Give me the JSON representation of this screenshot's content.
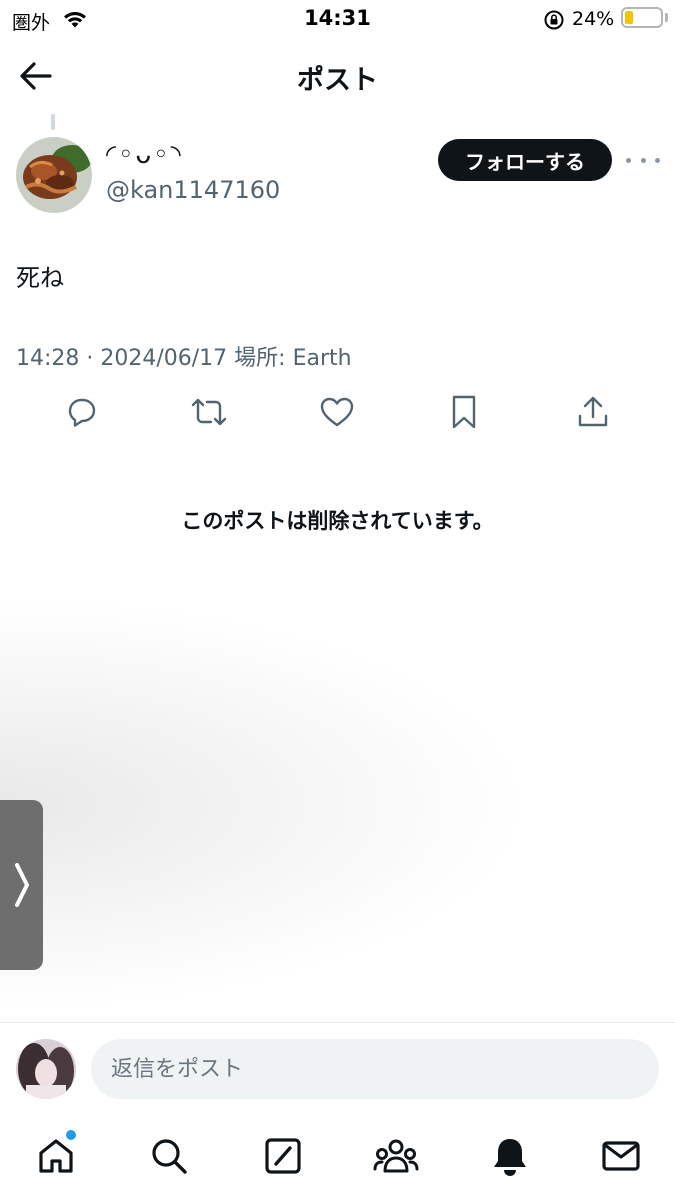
{
  "status_bar": {
    "carrier": "圏外",
    "time": "14:31",
    "battery_percent": "24%",
    "battery_level": 0.24,
    "icons": [
      "wifi-icon",
      "rotation-lock-icon",
      "battery-icon"
    ]
  },
  "header": {
    "title": "ポスト",
    "back_icon": "arrow-left-icon"
  },
  "author": {
    "display_name": "◜◦ᴗ◦◝",
    "handle": "@kan1147160",
    "follow_label": "フォローする",
    "more_icon": "more-horizontal-icon"
  },
  "post": {
    "text": "死ね",
    "meta": "14:28 · 2024/06/17 場所: Earth"
  },
  "actions": [
    {
      "icon": "reply-icon"
    },
    {
      "icon": "repost-icon"
    },
    {
      "icon": "like-icon"
    },
    {
      "icon": "bookmark-icon"
    },
    {
      "icon": "share-icon"
    }
  ],
  "deleted_notice": "このポストは削除されています。",
  "reply": {
    "placeholder": "返信をポスト"
  },
  "tabs": [
    {
      "icon": "home-icon",
      "has_badge": true
    },
    {
      "icon": "search-icon"
    },
    {
      "icon": "grok-icon"
    },
    {
      "icon": "communities-icon"
    },
    {
      "icon": "notifications-icon"
    },
    {
      "icon": "messages-icon"
    }
  ],
  "colors": {
    "accent": "#1d9bf0",
    "text": "#0f1419",
    "secondary": "#536471",
    "battery": "#f5c400"
  }
}
